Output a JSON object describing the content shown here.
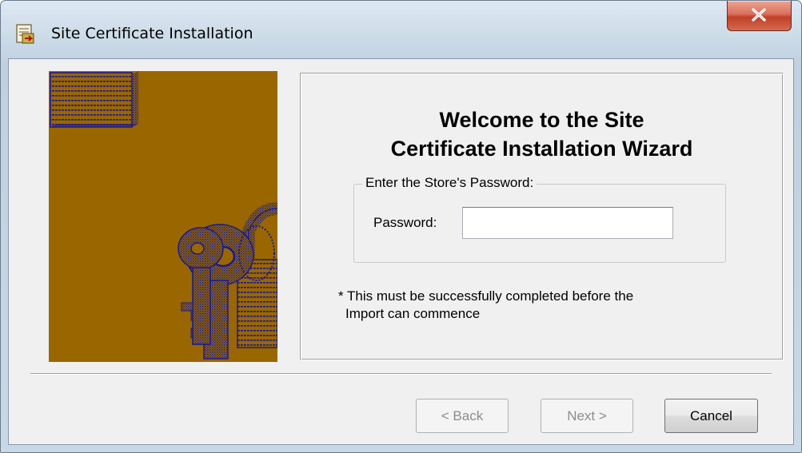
{
  "window": {
    "title": "Site Certificate Installation",
    "title_icon": "certificate-install-icon",
    "close_icon": "close-icon"
  },
  "side_image": {
    "icon": "keys-and-document-illustration",
    "background_color": "#996600",
    "ink_color": "#1a1a8a"
  },
  "welcome": {
    "title_line1": "Welcome to the Site",
    "title_line2": "Certificate Installation Wizard",
    "group_label": "Enter the Store's Password:",
    "password_label": "Password:",
    "password_value": "",
    "note_line1": "* This must be successfully completed before the",
    "note_line2": "Import can commence"
  },
  "buttons": {
    "back_label": "< Back",
    "next_label": "Next >",
    "cancel_label": "Cancel"
  }
}
